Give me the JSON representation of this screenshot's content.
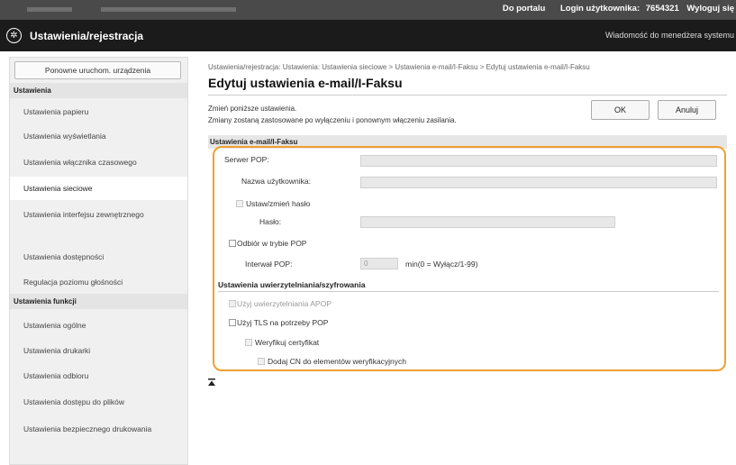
{
  "topbar": {
    "portal_link": "Do portalu",
    "login_label": "Login użytkownika:",
    "login_value": "7654321",
    "logout_link": "Wyloguj się"
  },
  "titlebar": {
    "title": "Ustawienia/rejestracja",
    "admin_message": "Wiadomość do menedżera systemu"
  },
  "sidebar": {
    "restart_button": "Ponowne uruchom. urządzenia",
    "section1": "Ustawienia",
    "items1": [
      "Ustawienia papieru",
      "Ustawienia wyświetlania",
      "Ustawienia włącznika czasowego",
      "Ustawienia sieciowe",
      "Ustawienia interfejsu zewnętrznego",
      "Ustawienia dostępności",
      "Regulacja poziomu głośności"
    ],
    "section2": "Ustawienia funkcji",
    "items2": [
      "Ustawienia ogólne",
      "Ustawienia drukarki",
      "Ustawienia odbioru",
      "Ustawienia dostępu do plików",
      "Ustawienia bezpiecznego drukowania"
    ]
  },
  "main": {
    "breadcrumb": "Ustawienia/rejestracja: Ustawienia: Ustawienia sieciowe > Ustawienia e-mail/I-Faksu > Edytuj ustawienia e-mail/I-Faksu",
    "page_title": "Edytuj ustawienia e-mail/I-Faksu",
    "info_line1": "Zmień poniższe ustawienia.",
    "info_line2": "Zmiany zostaną zastosowane po wyłączeniu i ponownym włączeniu zasilania.",
    "ok_button": "OK",
    "cancel_button": "Anuluj",
    "section_email": "Ustawienia e-mail/I-Faksu",
    "pop_server_label": "Serwer POP:",
    "username_label": "Nazwa użytkownika:",
    "set_password_label": "Ustaw/zmień hasło",
    "password_label": "Hasło:",
    "pop_rx_label": "Odbiór w trybie POP",
    "pop_interval_label": "Interwał POP:",
    "pop_interval_value": "0",
    "pop_interval_unit": "min(0 = Wyłącz/1-99)",
    "section_auth": "Ustawienia uwierzytelniania/szyfrowania",
    "apop_label": "Użyj uwierzytelniania APOP",
    "tls_label": "Użyj TLS na potrzeby POP",
    "verify_cert_label": "Weryfikuj certyfikat",
    "add_cn_label": "Dodaj CN do elementów weryfikacyjnych"
  }
}
